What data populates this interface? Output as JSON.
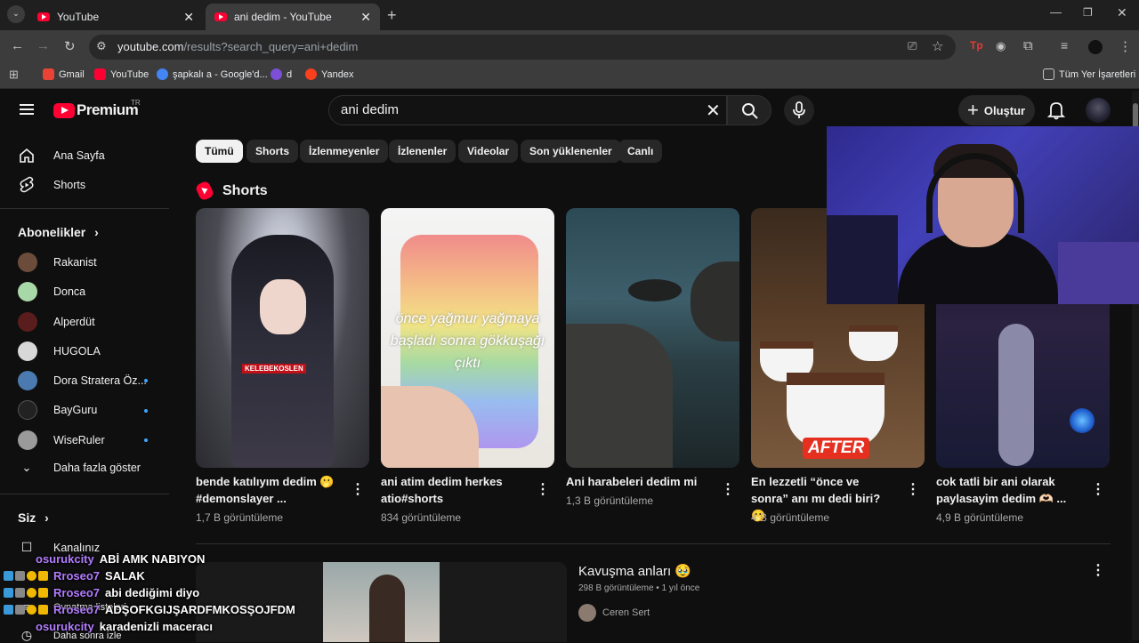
{
  "browser": {
    "tabs": [
      {
        "title": "YouTube"
      },
      {
        "title": "ani dedim - YouTube"
      }
    ],
    "url": {
      "host": "youtube.com",
      "path": "/results?search_query=ani+dedim"
    },
    "bookmarks": [
      {
        "label": "Gmail",
        "color": "#ea4335"
      },
      {
        "label": "YouTube",
        "color": "#ff0033"
      },
      {
        "label": "şapkalı a - Google'd...",
        "color": "#4285f4"
      },
      {
        "label": "d",
        "color": "#7b4fd6"
      },
      {
        "label": "Yandex",
        "color": "#fc3f1d"
      }
    ],
    "all_bookmarks_label": "Tüm Yer İşaretleri"
  },
  "header": {
    "logo_text": "Premium",
    "logo_region": "TR",
    "search_value": "ani dedim",
    "create_label": "Oluştur"
  },
  "sidebar": {
    "main": [
      {
        "label": "Ana Sayfa",
        "icon": "home-icon"
      },
      {
        "label": "Shorts",
        "icon": "shorts-icon"
      }
    ],
    "subscriptions_title": "Abonelikler",
    "channels": [
      {
        "label": "Rakanist",
        "color": "#6b4c3b",
        "new": false
      },
      {
        "label": "Donca",
        "color": "#a8d8a8",
        "new": false
      },
      {
        "label": "Alperdüt",
        "color": "#5a1d1d",
        "new": false
      },
      {
        "label": "HUGOLA",
        "color": "#d8d8d8",
        "new": false
      },
      {
        "label": "Dora Stratera Öz...",
        "color": "#4a7ab0",
        "new": true
      },
      {
        "label": "BayGuru",
        "color": "#222222",
        "new": true
      },
      {
        "label": "WiseRuler",
        "color": "#9a9a9a",
        "new": true
      }
    ],
    "show_more": "Daha fazla göster",
    "you_title": "Siz",
    "you_items": [
      {
        "label": "Kanalınız"
      },
      {
        "label": "Oynatma listeleri"
      },
      {
        "label": "Daha sonra izle"
      }
    ]
  },
  "chips": [
    {
      "label": "Tümü",
      "active": true
    },
    {
      "label": "Shorts",
      "active": false
    },
    {
      "label": "İzlenmeyenler",
      "active": false
    },
    {
      "label": "İzlenenler",
      "active": false
    },
    {
      "label": "Videolar",
      "active": false
    },
    {
      "label": "Son yüklenenler",
      "active": false
    },
    {
      "label": "Canlı",
      "active": false
    }
  ],
  "shorts_section": {
    "title": "Shorts",
    "items": [
      {
        "title": "bende katılıyım dedim 🫢 #demonslayer ...",
        "views": "1,7 B görüntüleme",
        "overlay": "KELEBEKOSLEN"
      },
      {
        "title": "ani atim dedim herkes atio#shorts",
        "views": "834 görüntüleme",
        "overlay": "önce yağmur yağmaya başladı sonra gökkuşağı çıktı"
      },
      {
        "title": "Ani harabeleri dedim mi",
        "views": "1,3 B görüntüleme",
        "overlay": ""
      },
      {
        "title": "En lezzetli “önce ve sonra” anı mı dedi biri?🫢",
        "views": "4 B görüntüleme",
        "overlay": "AFTER"
      },
      {
        "title": "cok tatli bir ani olarak paylasayim dedim 🫶🏻 ...",
        "views": "4,9 B görüntüleme",
        "overlay": ""
      }
    ]
  },
  "video": {
    "title": "Kavuşma anları 🥹",
    "meta": "298 B görüntüleme • 1 yıl önce",
    "channel": "Ceren Sert"
  },
  "chat": [
    {
      "user": "osurukcity",
      "message": "ABİ AMK NABIYON",
      "badges": 0
    },
    {
      "user": "Rroseo7",
      "message": "SALAK",
      "badges": 3
    },
    {
      "user": "Rroseo7",
      "message": "abi dediğimi diyo",
      "badges": 3
    },
    {
      "user": "Rroseo7",
      "message": "ADŞOFKGIJŞARDFMKOSŞOJFDM",
      "badges": 3
    },
    {
      "user": "osurukcity",
      "message": "karadenizli maceracı",
      "badges": 0
    }
  ]
}
